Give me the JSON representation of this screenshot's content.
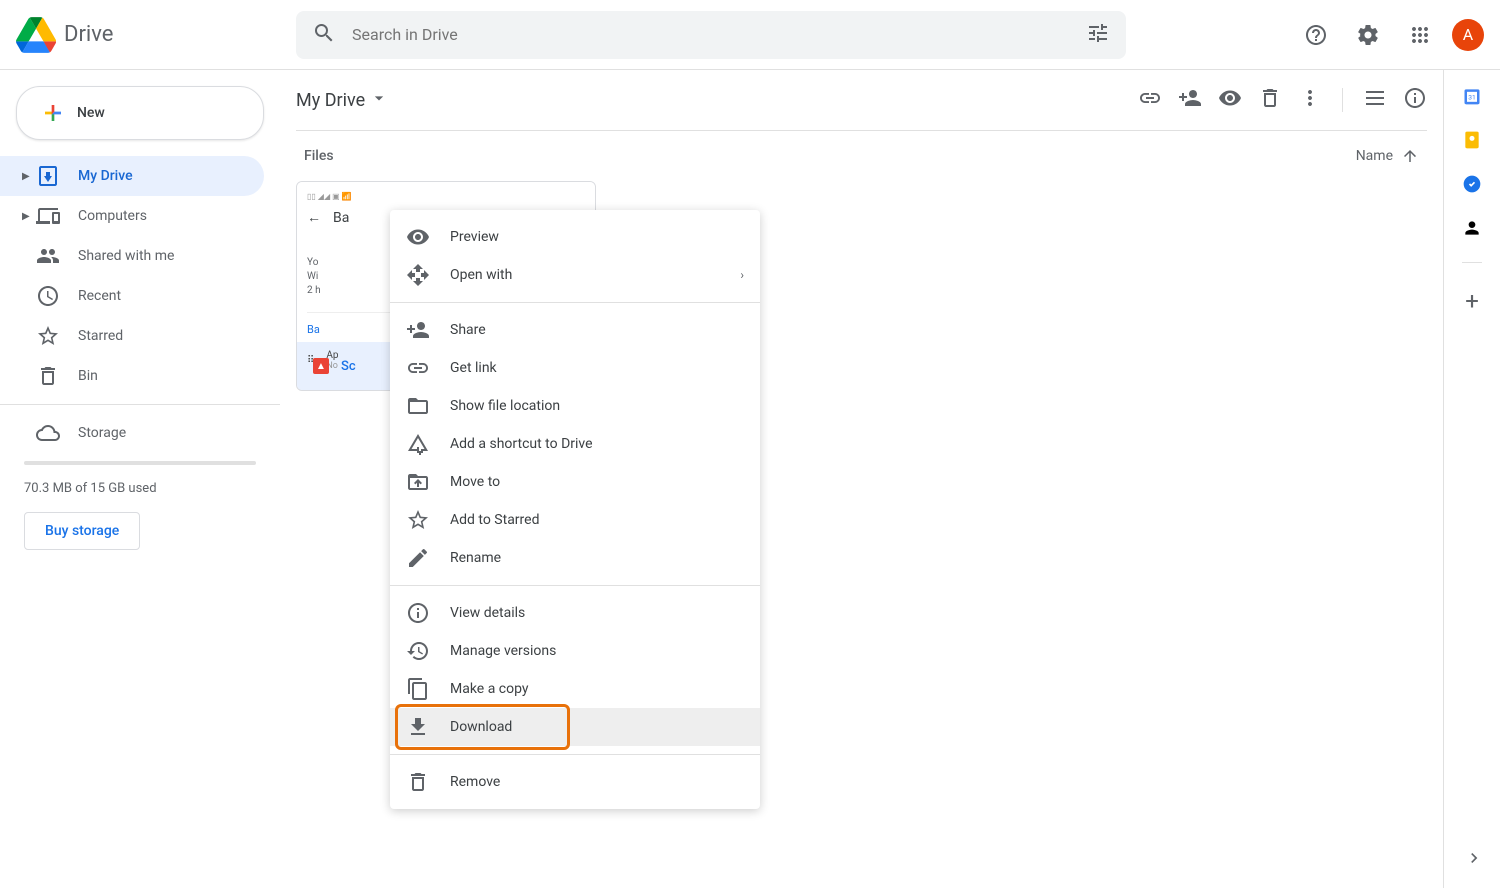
{
  "header": {
    "logo_text": "Drive",
    "search_placeholder": "Search in Drive",
    "avatar_letter": "A"
  },
  "sidebar": {
    "new_label": "New",
    "items": [
      {
        "label": "My Drive"
      },
      {
        "label": "Computers"
      },
      {
        "label": "Shared with me"
      },
      {
        "label": "Recent"
      },
      {
        "label": "Starred"
      },
      {
        "label": "Bin"
      }
    ],
    "storage_label": "Storage",
    "storage_text": "70.3 MB of 15 GB used",
    "buy_storage": "Buy storage"
  },
  "content": {
    "breadcrumb": "My Drive",
    "files_label": "Files",
    "sort_label": "Name",
    "file_card": {
      "back_label": "Ba",
      "body_line1": "Yo",
      "body_line2": "Wi",
      "body_line3": "2 h",
      "link": "Ba",
      "apps_label": "Ap",
      "apps_sub": "No",
      "filename": "Sc"
    }
  },
  "context_menu": {
    "items_g1": [
      {
        "label": "Preview"
      },
      {
        "label": "Open with"
      }
    ],
    "items_g2": [
      {
        "label": "Share"
      },
      {
        "label": "Get link"
      },
      {
        "label": "Show file location"
      },
      {
        "label": "Add a shortcut to Drive"
      },
      {
        "label": "Move to"
      },
      {
        "label": "Add to Starred"
      },
      {
        "label": "Rename"
      }
    ],
    "items_g3": [
      {
        "label": "View details"
      },
      {
        "label": "Manage versions"
      },
      {
        "label": "Make a copy"
      },
      {
        "label": "Download"
      }
    ],
    "items_g4": [
      {
        "label": "Remove"
      }
    ]
  }
}
